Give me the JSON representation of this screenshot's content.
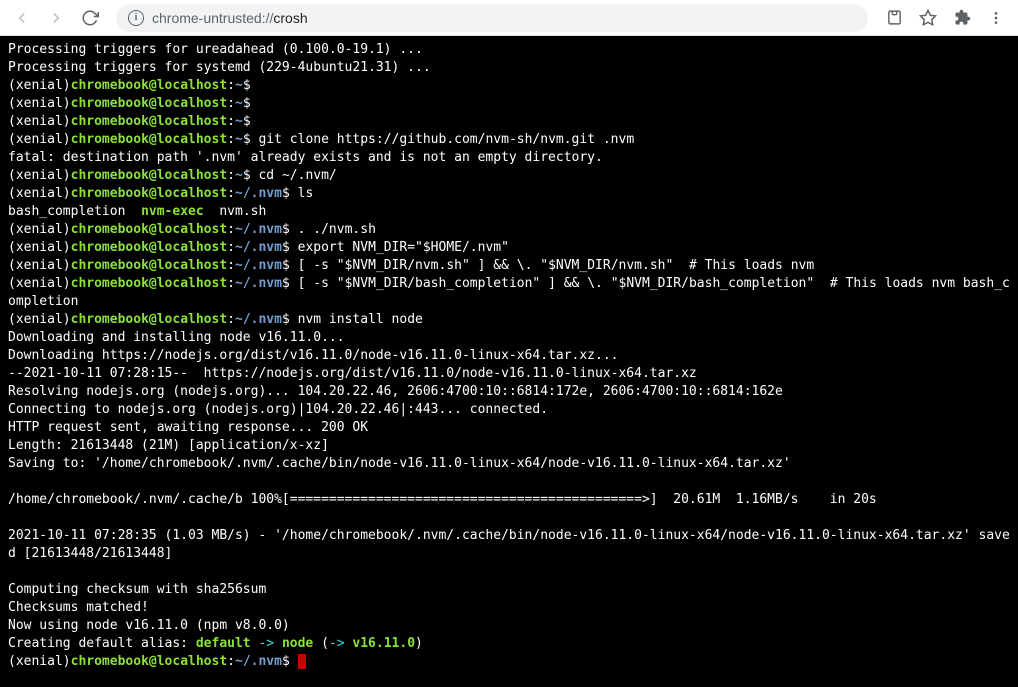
{
  "browser": {
    "url_scheme": "chrome-untrusted://",
    "url_path": "crosh"
  },
  "terminal": {
    "prompt": {
      "paren_open": "(xenial)",
      "user_host": "chromebook@localhost",
      "home_path": "~",
      "nvm_path": "~/.nvm"
    },
    "lines": {
      "l1": "Processing triggers for ureadahead (0.100.0-19.1) ...",
      "l2": "Processing triggers for systemd (229-4ubuntu21.31) ...",
      "cmd_gitclone": "git clone https://github.com/nvm-sh/nvm.git .nvm",
      "l_fatal": "fatal: destination path '.nvm' already exists and is not an empty directory.",
      "cmd_cd": "cd ~/.nvm/",
      "cmd_ls": "ls",
      "ls_bash": "bash_completion",
      "ls_nvmexec": "nvm-exec",
      "ls_nvmsh": "nvm.sh",
      "cmd_source": ". ./nvm.sh",
      "cmd_export": "export NVM_DIR=\"$HOME/.nvm\"",
      "cmd_load1": "[ -s \"$NVM_DIR/nvm.sh\" ] && \\. \"$NVM_DIR/nvm.sh\"  # This loads nvm",
      "cmd_load2": "[ -s \"$NVM_DIR/bash_completion\" ] && \\. \"$NVM_DIR/bash_completion\"  # This loads nvm bash_completion",
      "cmd_install": "nvm install node",
      "l_dl1": "Downloading and installing node v16.11.0...",
      "l_dl2": "Downloading https://nodejs.org/dist/v16.11.0/node-v16.11.0-linux-x64.tar.xz...",
      "l_dl3": "--2021-10-11 07:28:15--  https://nodejs.org/dist/v16.11.0/node-v16.11.0-linux-x64.tar.xz",
      "l_dl4": "Resolving nodejs.org (nodejs.org)... 104.20.22.46, 2606:4700:10::6814:172e, 2606:4700:10::6814:162e",
      "l_dl5": "Connecting to nodejs.org (nodejs.org)|104.20.22.46|:443... connected.",
      "l_dl6": "HTTP request sent, awaiting response... 200 OK",
      "l_dl7": "Length: 21613448 (21M) [application/x-xz]",
      "l_dl8": "Saving to: '/home/chromebook/.nvm/.cache/bin/node-v16.11.0-linux-x64/node-v16.11.0-linux-x64.tar.xz'",
      "l_prog": "/home/chromebook/.nvm/.cache/b 100%[=============================================>]  20.61M  1.16MB/s    in 20s",
      "l_done": "2021-10-11 07:28:35 (1.03 MB/s) - '/home/chromebook/.nvm/.cache/bin/node-v16.11.0-linux-x64/node-v16.11.0-linux-x64.tar.xz' saved [21613448/21613448]",
      "l_chk1": "Computing checksum with sha256sum",
      "l_chk2": "Checksums matched!",
      "l_now": "Now using node v16.11.0 (npm v8.0.0)",
      "alias_pre": "Creating default alias: ",
      "alias_default": "default",
      "alias_arrow1": " -> ",
      "alias_node": "node",
      "alias_paren_open": " (",
      "alias_arrow2": "-> ",
      "alias_version": "v16.11.0",
      "alias_paren_close": ")"
    }
  }
}
